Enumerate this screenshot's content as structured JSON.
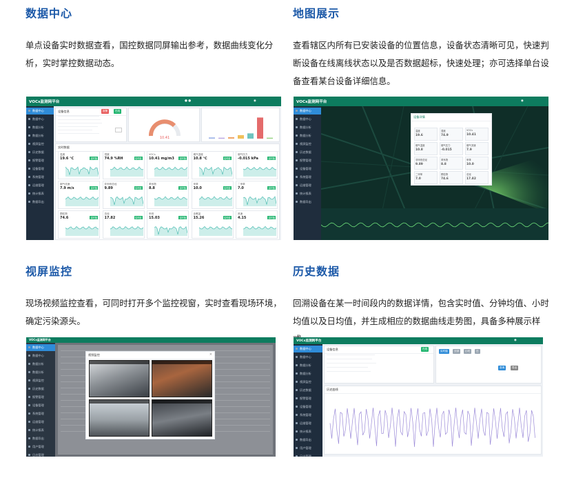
{
  "features": [
    {
      "title": "数据中心",
      "description": "单点设备实时数据查看，国控数据同屏输出参考，数据曲线变化分析，实时掌控数据动态。"
    },
    {
      "title": "地图展示",
      "description": "查看辖区内所有已安装设备的位置信息，设备状态清晰可见，快速判断设备在线离线状态以及是否数据超标，快速处理；亦可选择单台设备查看某台设备详细信息。"
    },
    {
      "title": "视屏监控",
      "description": "现场视频监控查看，可同时打开多个监控视窗，实时查看现场环境，确定污染源头。"
    },
    {
      "title": "历史数据",
      "description": "回溯设备在某一时间段内的数据详情，包含实时值、分钟均值、小时均值以及日均值，并生成相应的数据曲线走势图，具备多种展示样式。"
    }
  ],
  "app": {
    "logo": "VOCs监测网平台",
    "menu": [
      "数据中心",
      "数据中心",
      "数据分析",
      "数据分析",
      "视屏监控",
      "历史数据",
      "报警管理",
      "设备管理",
      "系统管理",
      "运维管理",
      "统计报表",
      "数据导出",
      "用户管理",
      "日志管理",
      "系统设置",
      "帮助中心"
    ],
    "colors": {
      "topbar": "#0d7c5f",
      "sidebar": "#1f2d3d",
      "active": "#2f8cd8",
      "online": "#21b56f",
      "alarm": "#e85d5d",
      "chart_line": "#5cc2b8",
      "history_line": "#9b8ad8"
    }
  },
  "dashboard": {
    "gauge_value": "10.41",
    "gauge_unit": "mg/m3",
    "tiles": [
      {
        "label": "温度",
        "value": "19.6",
        "unit": "℃",
        "badge": "实时值"
      },
      {
        "label": "湿度",
        "value": "74.9",
        "unit": "%RH",
        "badge": "实时值"
      },
      {
        "label": "VOCs",
        "value": "10.41",
        "unit": "mg/m3",
        "badge": "实时值"
      },
      {
        "label": "烟气温度",
        "value": "10.8",
        "unit": "℃",
        "badge": "实时值"
      },
      {
        "label": "烟气压力",
        "value": "-0.015",
        "unit": "kPa",
        "badge": "实时值"
      },
      {
        "label": "烟气流速",
        "value": "7.9",
        "unit": "m/s",
        "badge": "实时值"
      },
      {
        "label": "非甲烷总烃",
        "value": "9.89",
        "unit": "",
        "badge": "实时值"
      },
      {
        "label": "苯系物",
        "value": "8.8",
        "unit": "",
        "badge": "实时值"
      },
      {
        "label": "甲苯",
        "value": "10.0",
        "unit": "",
        "badge": "实时值"
      },
      {
        "label": "二甲苯",
        "value": "7.0",
        "unit": "",
        "badge": "实时值"
      },
      {
        "label": "颗粒物",
        "value": "74.6",
        "unit": "",
        "badge": "实时值"
      },
      {
        "label": "总烃",
        "value": "17.82",
        "unit": "",
        "badge": "实时值"
      },
      {
        "label": "甲烷",
        "value": "15.03",
        "unit": "",
        "badge": "实时值"
      },
      {
        "label": "含氧量",
        "value": "15.26",
        "unit": "",
        "badge": "实时值"
      },
      {
        "label": "风速",
        "value": "4.15",
        "unit": "",
        "badge": "实时值"
      }
    ],
    "bars": [
      4,
      3,
      5,
      12,
      18,
      72,
      3
    ]
  },
  "video": {
    "dialog_title": "视频监控",
    "feeds": 4
  },
  "history": {
    "points": 120
  }
}
